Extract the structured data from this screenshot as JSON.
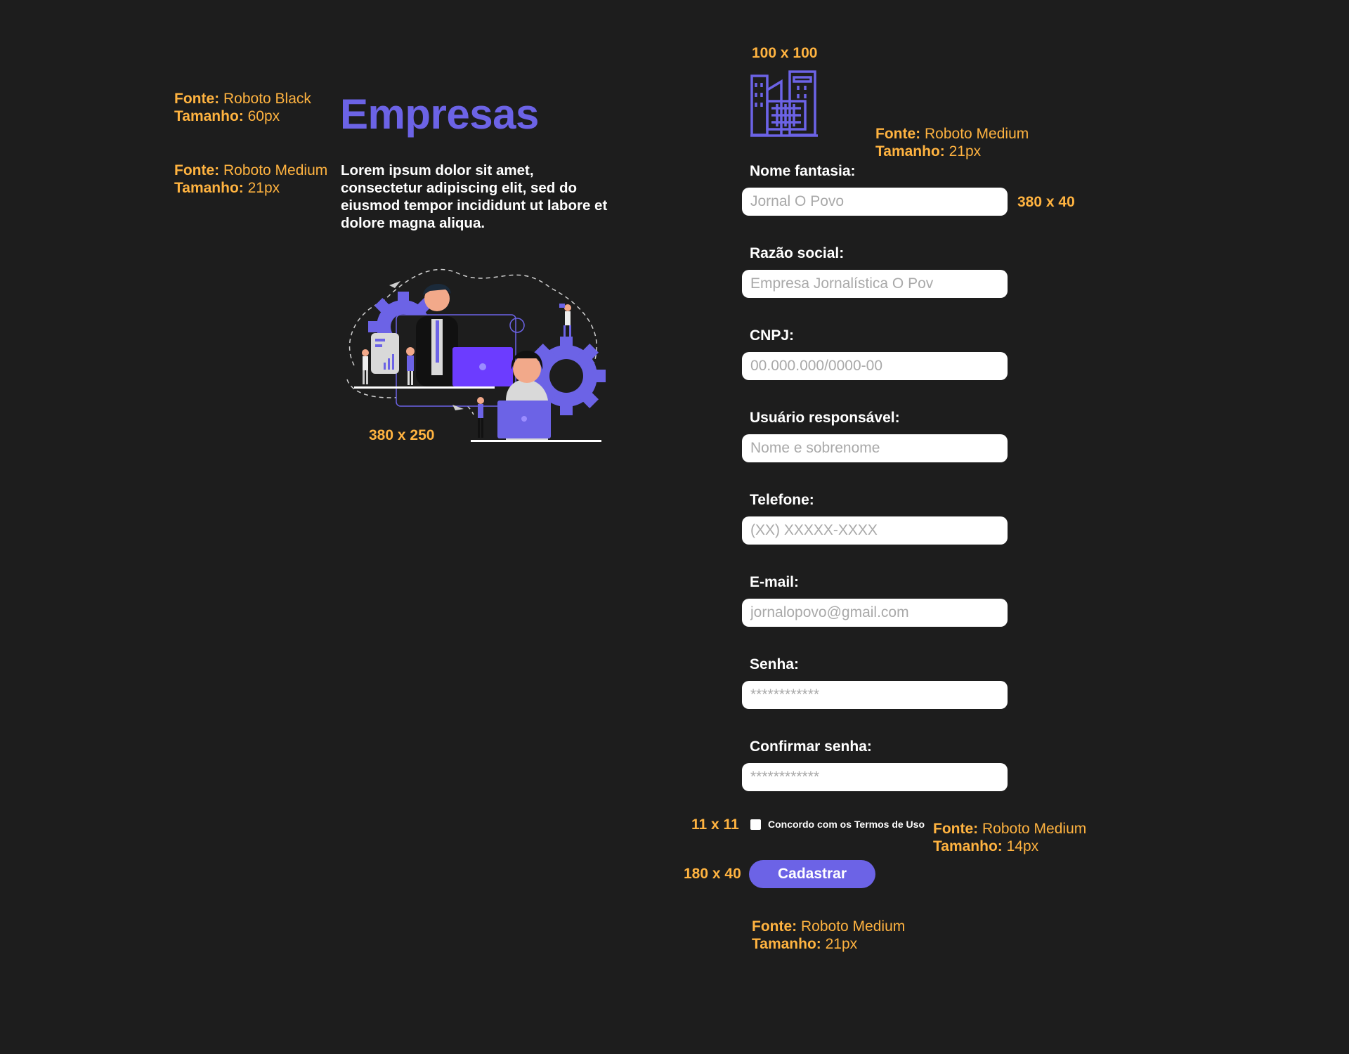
{
  "annotations": {
    "font_label": "Fonte:",
    "size_label": "Tamanho:",
    "title_spec": {
      "font": "Roboto Black",
      "size": "60px"
    },
    "intro_spec": {
      "font": "Roboto Medium",
      "size": "21px"
    },
    "form_spec": {
      "font": "Roboto Medium",
      "size": "21px"
    },
    "terms_spec": {
      "font": "Roboto Medium",
      "size": "14px"
    },
    "button_spec": {
      "font": "Roboto Medium",
      "size": "21px"
    },
    "logo_dim": "100 x 100",
    "input_dim": "380 x 40",
    "illustration_dim": "380 x 250",
    "checkbox_dim": "11 x 11",
    "button_dim": "180 x 40"
  },
  "header": {
    "title": "Empresas",
    "intro": "Lorem ipsum dolor sit amet, consectetur adipiscing elit, sed do eiusmod tempor incididunt ut labore et dolore magna aliqua."
  },
  "icons": {
    "logo": "building-icon",
    "illustration": "business-team-illustration"
  },
  "form": {
    "fields": [
      {
        "label": "Nome fantasia:",
        "placeholder": "Jornal O Povo"
      },
      {
        "label": "Razão social:",
        "placeholder": "Empresa Jornalística O Pov"
      },
      {
        "label": "CNPJ:",
        "placeholder": "00.000.000/0000-00"
      },
      {
        "label": "Usuário responsável:",
        "placeholder": "Nome e sobrenome"
      },
      {
        "label": "Telefone:",
        "placeholder": "(XX) XXXXX-XXXX"
      },
      {
        "label": "E-mail:",
        "placeholder": "jornalopovo@gmail.com"
      },
      {
        "label": "Senha:",
        "placeholder": "************"
      },
      {
        "label": "Confirmar senha:",
        "placeholder": "************"
      }
    ],
    "terms_label": "Concordo com os Termos de Uso",
    "submit_label": "Cadastrar"
  },
  "colors": {
    "background": "#1d1d1d",
    "accent": "#6c63e6",
    "annotation": "#ffb340",
    "text": "#ffffff"
  }
}
